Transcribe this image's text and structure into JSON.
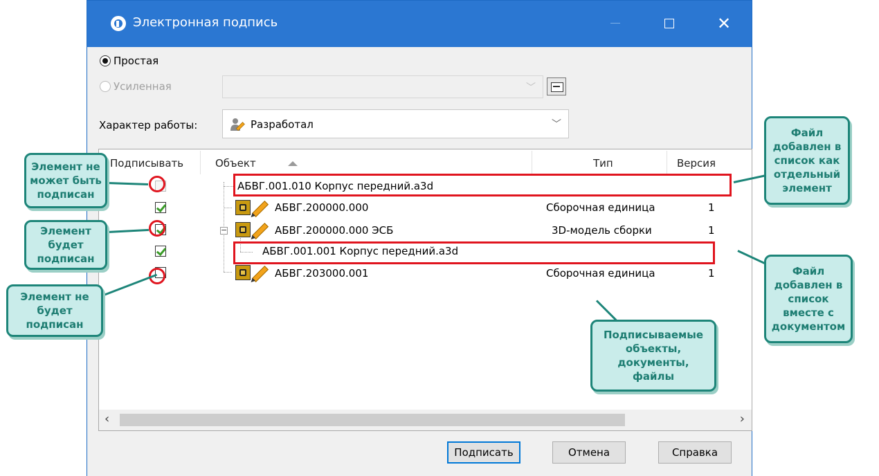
{
  "window": {
    "title": "Электронная подпись",
    "min_label": "",
    "close_label": "✕"
  },
  "signature_type": {
    "simple_label": "Простая",
    "simple_selected": true,
    "enhanced_label": "Усиленная",
    "enhanced_enabled": false,
    "certificate_value": ""
  },
  "work_nature": {
    "label": "Характер работы:",
    "value": "Разработал",
    "icon": "person-pencil-icon"
  },
  "tree": {
    "columns": [
      "Подписывать",
      "Объект",
      "Тип",
      "Версия"
    ],
    "sort_column": "Объект",
    "rows": [
      {
        "object": "АБВГ.001.010 Корпус передний.a3d",
        "type": "",
        "version": "",
        "check": "disabled"
      },
      {
        "object": "АБВГ.200000.000",
        "type": "Сборочная единица",
        "version": "1",
        "check": "checked"
      },
      {
        "object": "АБВГ.200000.000 ЭСБ",
        "type": "3D-модель сборки",
        "version": "1",
        "check": "checked"
      },
      {
        "object": "АБВГ.001.001 Корпус передний.a3d",
        "type": "",
        "version": "",
        "check": "checked"
      },
      {
        "object": "АБВГ.203000.001",
        "type": "Сборочная единица",
        "version": "1",
        "check": "unchecked"
      }
    ]
  },
  "scroll": {
    "left": "‹",
    "right": "›"
  },
  "buttons": {
    "sign": "Подписать",
    "cancel": "Отмена",
    "help": "Справка"
  },
  "callouts": {
    "cannot_sign": "Элемент не\nможет быть\nподписан",
    "will_sign": "Элемент\nбудет\nподписан",
    "will_not_sign": "Элемент не\nбудет\nподписан",
    "file_separate": "Файл\nдобавлен в\nсписок как\nотдельный\nэлемент",
    "file_with_doc": "Файл\nдобавлен в\nсписок\nвместе с\nдокументом",
    "signed_objects": "Подписываемые\nобъекты,\nдокументы,\nфайлы"
  },
  "colors": {
    "titlebar": "#2b77d2",
    "highlight_red": "#e0141e",
    "callout_fill": "#c9ecea",
    "callout_border": "#1d8579",
    "checkmark": "#3a9c28"
  }
}
